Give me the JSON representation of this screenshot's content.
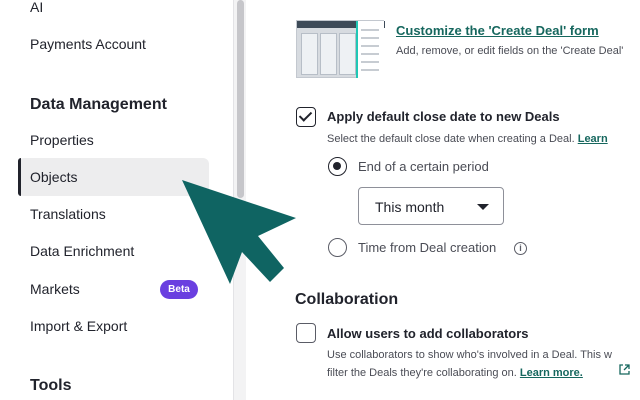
{
  "sidebar": {
    "items": [
      {
        "label": "AI"
      },
      {
        "label": "Payments Account"
      },
      {
        "label": "Properties"
      },
      {
        "label": "Objects"
      },
      {
        "label": "Translations"
      },
      {
        "label": "Data Enrichment"
      },
      {
        "label": "Markets",
        "badge": "Beta"
      },
      {
        "label": "Import & Export"
      }
    ],
    "sections": {
      "data_management": "Data Management",
      "tools": "Tools"
    },
    "active_item": "Objects"
  },
  "main": {
    "create_deal_form": {
      "title": "Customize the 'Create Deal' form",
      "description": "Add, remove, or edit fields on the 'Create Deal'"
    },
    "default_close_date": {
      "label": "Apply default close date to new Deals",
      "checked": true,
      "helper": "Select the default close date when creating a Deal.",
      "helper_link": "Learn",
      "options": [
        {
          "label": "End of a certain period",
          "selected": true
        },
        {
          "label": "Time from Deal creation",
          "selected": false
        }
      ],
      "period_select": {
        "value": "This month"
      }
    },
    "collaboration": {
      "heading": "Collaboration",
      "label": "Allow users to add collaborators",
      "checked": false,
      "helper_line1": "Use collaborators to show who's involved in a Deal. This w",
      "helper_line2": "filter the Deals they're collaborating on.",
      "helper_link": "Learn more."
    }
  },
  "colors": {
    "accent": "#16675e",
    "cursor": "#0f6462",
    "badge": "#6a3fe0"
  },
  "icons": {
    "cursor": "arrow-cursor-icon",
    "info": "info-icon",
    "external_link": "external-link-icon"
  }
}
